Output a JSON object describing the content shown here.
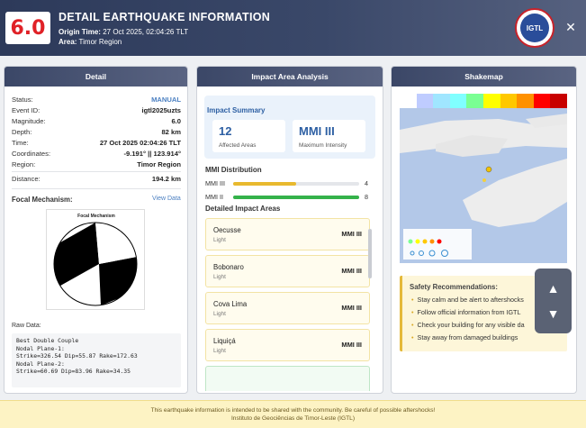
{
  "header": {
    "magnitude_badge": "6.0",
    "title": "DETAIL EARTHQUAKE INFORMATION",
    "origin_label": "Origin Time:",
    "origin_value": "27 Oct 2025, 02:04:26 TLT",
    "area_label": "Area:",
    "area_value": "Timor Region",
    "logo_text": "IGTL",
    "close_icon": "close-icon"
  },
  "detail": {
    "title": "Detail",
    "fields": [
      {
        "label": "Status:",
        "value": "MANUAL"
      },
      {
        "label": "Event ID:",
        "value": "igtl2025uzts"
      },
      {
        "label": "Magnitude:",
        "value": "6.0"
      },
      {
        "label": "Depth:",
        "value": "82 km"
      },
      {
        "label": "Time:",
        "value": "27 Oct 2025 02:04:26 TLT"
      },
      {
        "label": "Coordinates:",
        "value": "-9.191° || 123.914°"
      },
      {
        "label": "Region:",
        "value": "Timor Region"
      }
    ],
    "distance_label": "Distance:",
    "distance_value": "194.2 km",
    "focal_label": "Focal Mechanism:",
    "view_data": "View Data",
    "beachball_title": "Focal Mechanism",
    "raw_label": "Raw Data:",
    "raw_text": "Best Double Couple\nNodal Plane-1:\nStrike=326.54 Dip=55.87 Rake=172.63\nNodal Plane-2:\nStrike=60.69 Dip=83.96 Rake=34.35"
  },
  "impact": {
    "title": "Impact Area Analysis",
    "summary_title": "Impact Summary",
    "affected_value": "12",
    "affected_label": "Affected Areas",
    "max_value": "MMI III",
    "max_label": "Maximum Intensity",
    "dist_title": "MMI Distribution",
    "distribution": [
      {
        "name": "MMI III",
        "count": "4",
        "fraction": 0.5,
        "color": "#e8b92e"
      },
      {
        "name": "MMI II",
        "count": "8",
        "fraction": 1.0,
        "color": "#34b24a"
      }
    ],
    "areas_title": "Detailed Impact Areas",
    "areas": [
      {
        "name": "Oecusse",
        "intensity": "Light",
        "mmi": "MMI III"
      },
      {
        "name": "Bobonaro",
        "intensity": "Light",
        "mmi": "MMI III"
      },
      {
        "name": "Cova Lima",
        "intensity": "Light",
        "mmi": "MMI III"
      },
      {
        "name": "Liquiçá",
        "intensity": "Light",
        "mmi": "MMI III"
      }
    ]
  },
  "shakemap": {
    "title": "Shakemap",
    "safety_title": "Safety Recommendations:",
    "safety_items": [
      "Stay calm and be alert to aftershocks",
      "Follow official information from IGTL",
      "Check your building for any visible da",
      "Stay away from damaged buildings"
    ]
  },
  "nav": {
    "up_icon": "▲",
    "down_icon": "▼"
  },
  "footer": {
    "line1": "This earthquake information is intended to be shared with the community. Be careful of possible aftershocks!",
    "line2": "Instituto de Geociências de Timor-Leste (IGTL)"
  }
}
